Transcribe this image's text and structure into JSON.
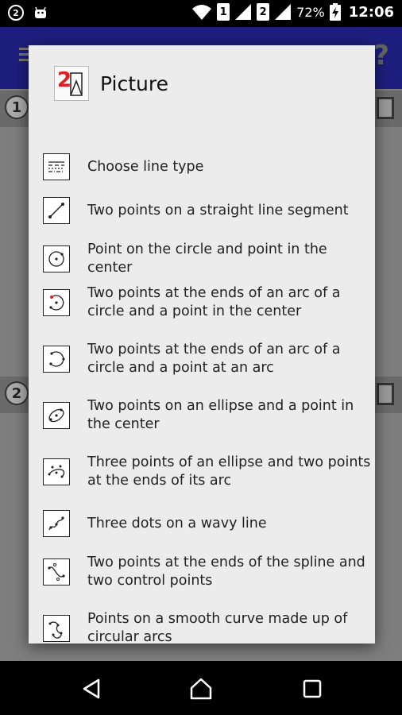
{
  "status_bar": {
    "badge": "2",
    "sim1": "1",
    "sim2": "2",
    "battery": "72%",
    "time": "12:06"
  },
  "background_app": {
    "strip1_number": "1",
    "strip2_number": "2",
    "help_glyph": "?",
    "toolbar_color": "#1e1e7e"
  },
  "dialog": {
    "title": "Picture",
    "logo_number": "2",
    "items": [
      {
        "label": "Choose line type",
        "icon": "line-type-icon"
      },
      {
        "label": "Two points on a straight line segment",
        "icon": "line-segment-icon"
      },
      {
        "label": "Point on the circle and point in the center",
        "icon": "circle-center-icon"
      },
      {
        "label": "Two points at the ends of an arc of a circle and a point in the center",
        "icon": "arc-center-icon"
      },
      {
        "label": "Two points at the ends of an arc of a circle and a point at an arc",
        "icon": "arc-point-icon"
      },
      {
        "label": "Two points on an ellipse and a point in the center",
        "icon": "ellipse-center-icon"
      },
      {
        "label": "Three points of an ellipse and two points at the ends of its arc",
        "icon": "ellipse-arc-icon"
      },
      {
        "label": "Three dots on a wavy line",
        "icon": "wavy-line-icon"
      },
      {
        "label": "Two points at the ends of the spline and two control points",
        "icon": "spline-icon"
      },
      {
        "label": "Points on a smooth curve made up of circular arcs",
        "icon": "smooth-curve-icon"
      }
    ]
  }
}
